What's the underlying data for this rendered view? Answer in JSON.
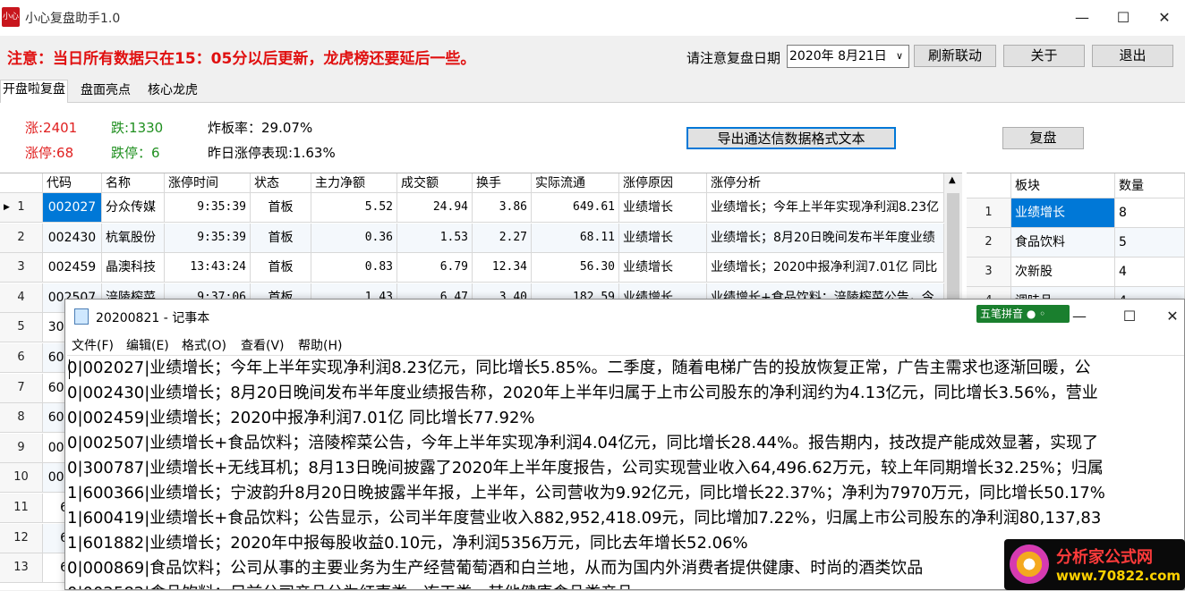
{
  "window": {
    "title": "小心复盘助手1.0",
    "logo_text": "小心",
    "minimize": "—",
    "maximize": "☐",
    "close": "✕"
  },
  "notice": "注意：当日所有数据只在15：05分以后更新，龙虎榜还要延后一些。",
  "date_label": "请注意复盘日期",
  "date_value": "2020年 8月21日",
  "buttons": {
    "refresh": "刷新联动",
    "about": "关于",
    "exit": "退出",
    "export": "导出通达信数据格式文本",
    "replay": "复盘"
  },
  "tabs": [
    "开盘啦复盘",
    "盘面亮点",
    "核心龙虎"
  ],
  "stats": {
    "up": "涨:2401",
    "down": "跌:1330",
    "limit_up": "涨停:68",
    "limit_down": "跌停：6",
    "break_rate": "炸板率：29.07%",
    "yesterday": "昨日涨停表现:1.63%"
  },
  "grid": {
    "headers": [
      "代码",
      "名称",
      "涨停时间",
      "状态",
      "主力净额",
      "成交额",
      "换手",
      "实际流通",
      "涨停原因",
      "涨停分析"
    ],
    "rows": [
      [
        "1",
        "002027",
        "分众传媒",
        "9:35:39",
        "首板",
        "5.52",
        "24.94",
        "3.86",
        "649.61",
        "业绩增长",
        "业绩增长；今年上半年实现净利润8.23亿"
      ],
      [
        "2",
        "002430",
        "杭氧股份",
        "9:35:39",
        "首板",
        "0.36",
        "1.53",
        "2.27",
        "68.11",
        "业绩增长",
        "业绩增长；8月20日晚间发布半年度业绩"
      ],
      [
        "3",
        "002459",
        "晶澳科技",
        "13:43:24",
        "首板",
        "0.83",
        "6.79",
        "12.34",
        "56.30",
        "业绩增长",
        "业绩增长；2020中报净利润7.01亿 同比"
      ],
      [
        "4",
        "002507",
        "涪陵榨菜",
        "9:37:06",
        "首板",
        "1.43",
        "6.47",
        "3.40",
        "182.59",
        "业绩增长",
        "业绩增长+食品饮料；涪陵榨菜公告，今"
      ],
      [
        "5",
        "300787",
        "",
        "",
        "",
        "",
        "",
        "",
        "",
        "",
        ""
      ],
      [
        "6",
        "600366",
        "",
        "",
        "",
        "",
        "",
        "",
        "",
        "",
        ""
      ],
      [
        "7",
        "600419",
        "",
        "",
        "",
        "",
        "",
        "",
        "",
        "",
        ""
      ],
      [
        "8",
        "601882",
        "",
        "",
        "",
        "",
        "",
        "",
        "",
        "",
        ""
      ],
      [
        "9",
        "000869",
        "",
        "",
        "",
        "",
        "",
        "",
        "",
        "",
        ""
      ],
      [
        "10",
        "002582",
        "",
        "",
        "",
        "",
        "",
        "",
        "",
        "",
        ""
      ],
      [
        "11",
        "600",
        "",
        "",
        "",
        "",
        "",
        "",
        "",
        "",
        ""
      ],
      [
        "12",
        "600",
        "",
        "",
        "",
        "",
        "",
        "",
        "",
        "",
        ""
      ],
      [
        "13",
        "600",
        "",
        "",
        "",
        "",
        "",
        "",
        "",
        "",
        ""
      ]
    ]
  },
  "side_grid": {
    "headers": [
      "板块",
      "数量"
    ],
    "rows": [
      [
        "1",
        "业绩增长",
        "8"
      ],
      [
        "2",
        "食品饮料",
        "5"
      ],
      [
        "3",
        "次新股",
        "4"
      ],
      [
        "4",
        "调味品",
        "4"
      ]
    ]
  },
  "notepad": {
    "title": "20200821 - 记事本",
    "ime": "五笔拼音 ● ◦",
    "menu": [
      "文件(F)",
      "编辑(E)",
      "格式(O)",
      "查看(V)",
      "帮助(H)"
    ],
    "lines": [
      "0|002027|业绩增长；今年上半年实现净利润8.23亿元，同比增长5.85%。二季度，随着电梯广告的投放恢复正常，广告主需求也逐渐回暖，公",
      "0|002430|业绩增长；8月20日晚间发布半年度业绩报告称，2020年上半年归属于上市公司股东的净利润约为4.13亿元，同比增长3.56%，营业",
      "0|002459|业绩增长；2020中报净利润7.01亿 同比增长77.92%",
      "0|002507|业绩增长+食品饮料；涪陵榨菜公告，今年上半年实现净利润4.04亿元，同比增长28.44%。报告期内，技改提产能成效显著，实现了",
      "0|300787|业绩增长+无线耳机；8月13日晚间披露了2020年上半年度报告，公司实现营业收入64,496.62万元，较上年同期增长32.25%；归属",
      "1|600366|业绩增长；宁波韵升8月20日晚披露半年报，上半年，公司营收为9.92亿元，同比增长22.37%；净利为7970万元，同比增长50.17%",
      "1|600419|业绩增长+食品饮料；公告显示，公司半年度营业收入882,952,418.09元，同比增加7.22%，归属上市公司股东的净利润80,137,83",
      "1|601882|业绩增长；2020年中报每股收益0.10元，净利润5356万元，同比去年增长52.06%",
      "0|000869|食品饮料；公司从事的主要业务为生产经营葡萄酒和白兰地，从而为国内外消费者提供健康、时尚的酒类饮品",
      "0|002582|食品饮料；目前公司产品分为红枣类、冻干类、其他健康食品类产品"
    ]
  },
  "watermark": {
    "line1": "分析家公式网",
    "line2": "www.70822.com"
  }
}
